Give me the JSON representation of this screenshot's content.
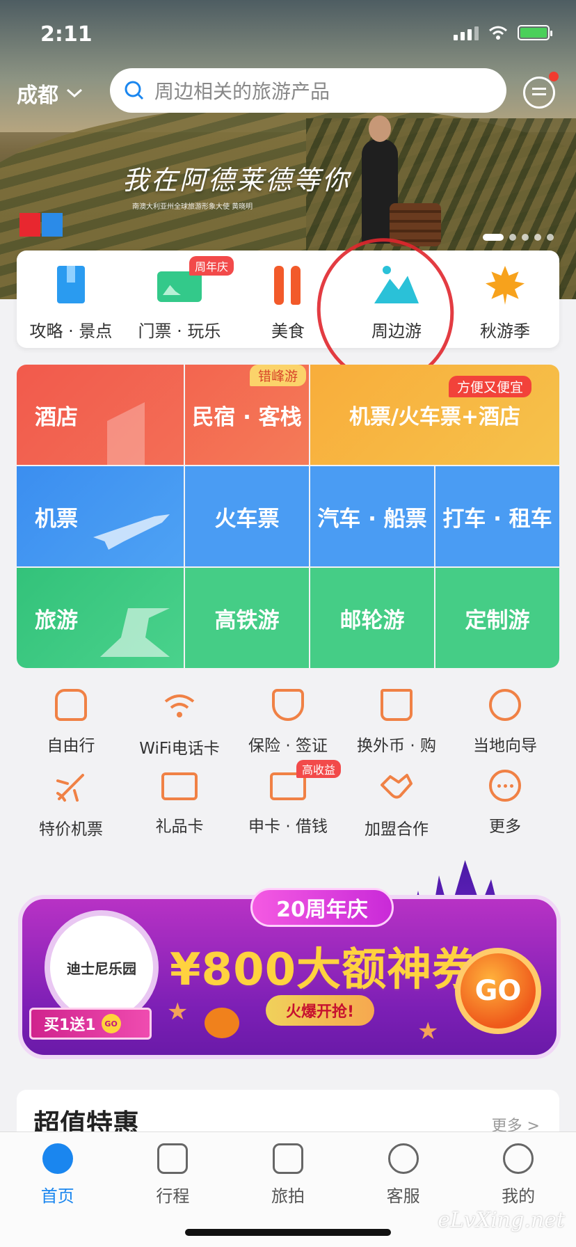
{
  "status": {
    "time": "2:11"
  },
  "header": {
    "city": "成都",
    "search_placeholder": "周边相关的旅游产品"
  },
  "banner": {
    "slogan": "我在阿德莱德等你",
    "subtitle": "南澳大利亚州全球旅游形象大使 黄晓明"
  },
  "categories": [
    {
      "label": "攻略 · 景点",
      "icon": "guide-book-icon",
      "color": "#2a9bf0"
    },
    {
      "label": "门票 · 玩乐",
      "icon": "ticket-icon",
      "color": "#33c98a",
      "tag": "周年庆"
    },
    {
      "label": "美食",
      "icon": "fork-knife-icon",
      "color": "#f25a2a"
    },
    {
      "label": "周边游",
      "icon": "mountain-icon",
      "color": "#2ac1d8"
    },
    {
      "label": "秋游季",
      "icon": "maple-leaf-icon",
      "color": "#f7a21c"
    }
  ],
  "grid": {
    "hotel": "酒店",
    "homestay": "民宿 · 客栈",
    "homestay_tag": "错峰游",
    "flight_hotel": "机票/火车票+酒店",
    "flight_hotel_tag": "方便又便宜",
    "flight": "机票",
    "train": "火车票",
    "bus_ship": "汽车 · 船票",
    "taxi_rental": "打车 · 租车",
    "travel": "旅游",
    "rail_tour": "高铁游",
    "cruise": "邮轮游",
    "custom": "定制游"
  },
  "services_row1": [
    {
      "label": "自由行",
      "icon": "backpack-icon"
    },
    {
      "label": "WiFi电话卡",
      "icon": "wifi-icon"
    },
    {
      "label": "保险 · 签证",
      "icon": "shield-globe-icon"
    },
    {
      "label": "换外币 · 购",
      "icon": "shopping-bag-icon"
    },
    {
      "label": "当地向导",
      "icon": "guide-hat-icon"
    }
  ],
  "services_row2": [
    {
      "label": "特价机票",
      "icon": "plane-icon"
    },
    {
      "label": "礼品卡",
      "icon": "gift-card-icon"
    },
    {
      "label": "申卡 · 借钱",
      "icon": "credit-card-icon",
      "tag": "高收益"
    },
    {
      "label": "加盟合作",
      "icon": "handshake-icon"
    },
    {
      "label": "更多",
      "icon": "more-dots-icon"
    }
  ],
  "promo": {
    "park": "迪士尼乐园",
    "buy_tag": "买1送1",
    "go_mini": "GO",
    "anniversary": "20周年庆",
    "coupon": "¥800大额神券",
    "hot": "火爆开抢!",
    "go": "GO"
  },
  "deals": {
    "title": "超值特惠",
    "more": "更多 >"
  },
  "tabbar": [
    {
      "label": "首页",
      "icon": "dolphin-home-icon",
      "active": true
    },
    {
      "label": "行程",
      "icon": "calendar-icon"
    },
    {
      "label": "旅拍",
      "icon": "camera-play-icon"
    },
    {
      "label": "客服",
      "icon": "headset-icon"
    },
    {
      "label": "我的",
      "icon": "user-icon"
    }
  ],
  "watermark": "eLvXing.net",
  "colors": {
    "accent": "#1a86ef",
    "red": "#f25545",
    "blue": "#3b8ef0",
    "green": "#38c47a"
  }
}
